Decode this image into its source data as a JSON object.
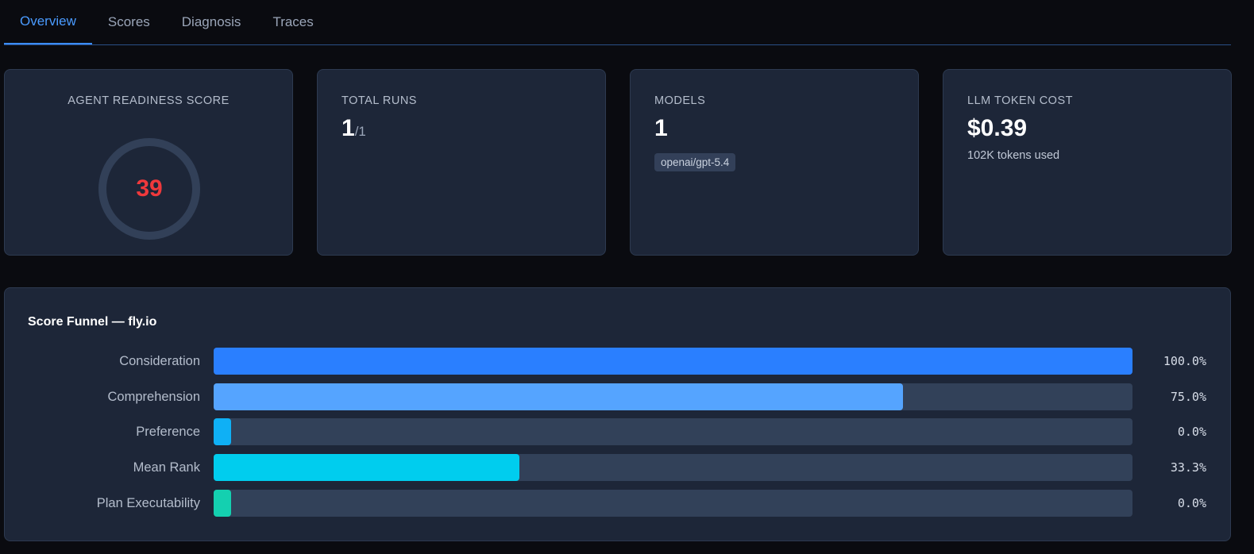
{
  "tabs": [
    {
      "label": "Overview",
      "active": true
    },
    {
      "label": "Scores",
      "active": false
    },
    {
      "label": "Diagnosis",
      "active": false
    },
    {
      "label": "Traces",
      "active": false
    }
  ],
  "cards": {
    "readiness": {
      "label": "AGENT READINESS SCORE",
      "value": "39",
      "color": "#f0393c"
    },
    "runs": {
      "label": "TOTAL RUNS",
      "value": "1",
      "sub": "/1"
    },
    "models": {
      "label": "MODELS",
      "value": "1",
      "chip": "openai/gpt-5.4"
    },
    "cost": {
      "label": "LLM TOKEN COST",
      "value": "$0.39",
      "note": "102K tokens used"
    }
  },
  "funnel": {
    "title": "Score Funnel — fly.io",
    "rows": [
      {
        "label": "Consideration",
        "value": "100.0%",
        "pct": 100.0,
        "color": "#2a7fff"
      },
      {
        "label": "Comprehension",
        "value": "75.0%",
        "pct": 75.0,
        "color": "#55a4ff"
      },
      {
        "label": "Preference",
        "value": "0.0%",
        "pct": 0.0,
        "color": "#0fb0f5"
      },
      {
        "label": "Mean Rank",
        "value": "33.3%",
        "pct": 33.3,
        "color": "#00cdee"
      },
      {
        "label": "Plan Executability",
        "value": "0.0%",
        "pct": 0.0,
        "color": "#14d0b0"
      }
    ]
  }
}
